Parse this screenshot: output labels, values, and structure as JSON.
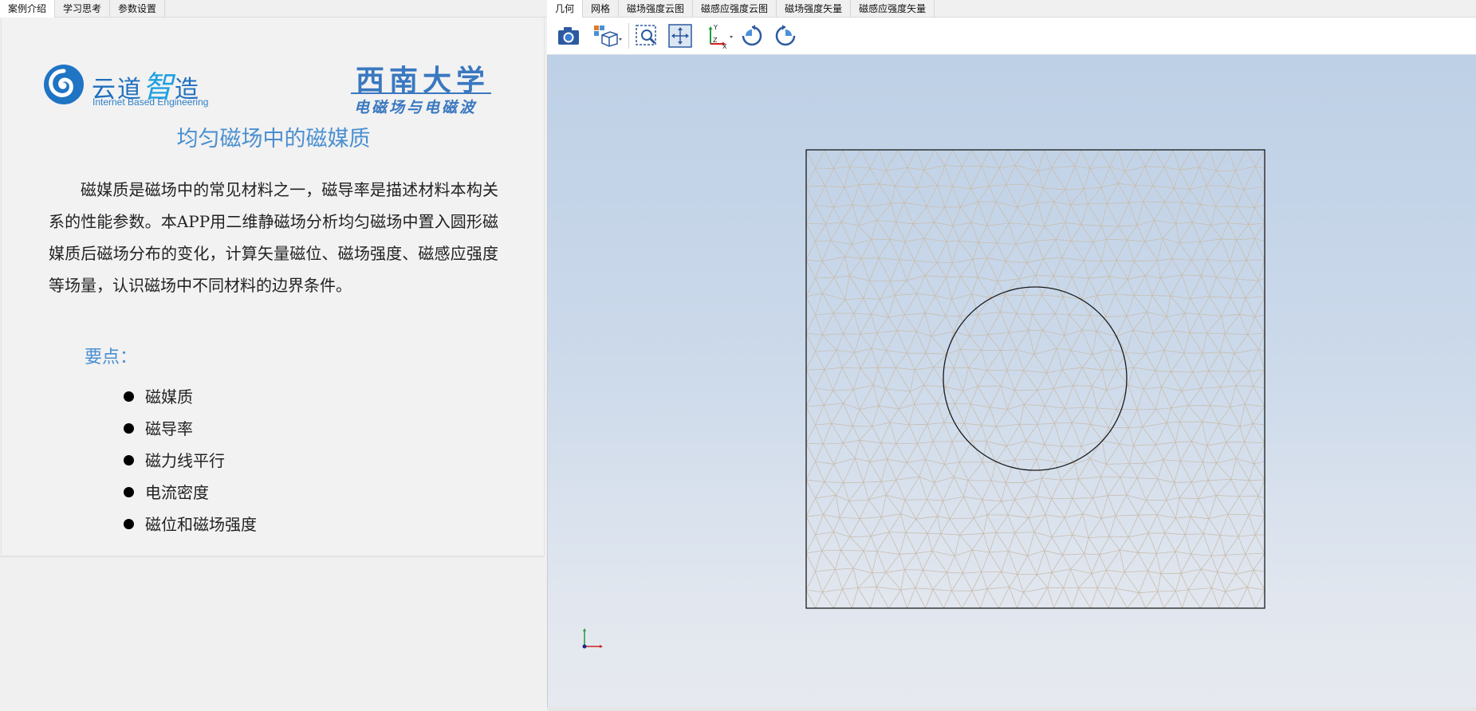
{
  "left_tabs": [
    {
      "label": "案例介绍",
      "active": true
    },
    {
      "label": "学习思考",
      "active": false
    },
    {
      "label": "参数设置",
      "active": false
    }
  ],
  "logo_yundao": {
    "cn_part1": "云道",
    "cn_part2": "智",
    "cn_part3": "造",
    "en": "Internet Based Engineering"
  },
  "logo_swu": {
    "name": "西南大学",
    "subtitle": "电磁场与电磁波"
  },
  "intro": {
    "title": "均匀磁场中的磁媒质",
    "description": "磁媒质是磁场中的常见材料之一，磁导率是描述材料本构关系的性能参数。本APP用二维静磁场分析均匀磁场中置入圆形磁媒质后磁场分布的变化，计算矢量磁位、磁场强度、磁感应强度等场量，认识磁场中不同材料的边界条件。",
    "points_heading": "要点：",
    "points": [
      "磁媒质",
      "磁导率",
      "磁力线平行",
      "电流密度",
      "磁位和磁场强度"
    ]
  },
  "right_tabs": [
    {
      "label": "几何",
      "active": true
    },
    {
      "label": "网格",
      "active": false
    },
    {
      "label": "磁场强度云图",
      "active": false
    },
    {
      "label": "磁感应强度云图",
      "active": false
    },
    {
      "label": "磁场强度矢量",
      "active": false
    },
    {
      "label": "磁感应强度矢量",
      "active": false
    }
  ],
  "toolbar": [
    {
      "name": "camera-icon"
    },
    {
      "name": "view-cube-icon"
    },
    {
      "name": "zoom-box-icon"
    },
    {
      "name": "zoom-extents-icon"
    },
    {
      "name": "axis-orientation-icon",
      "axis_labels": [
        "Y",
        "Z",
        "X"
      ]
    },
    {
      "name": "rotate-ccw-icon"
    },
    {
      "name": "rotate-cw-icon"
    }
  ],
  "colors": {
    "accent_blue": "#4a8fd0",
    "mesh_line": "#c8beb0",
    "viewport_top": "#bed0e6",
    "viewport_bottom": "#e6e9ef"
  }
}
